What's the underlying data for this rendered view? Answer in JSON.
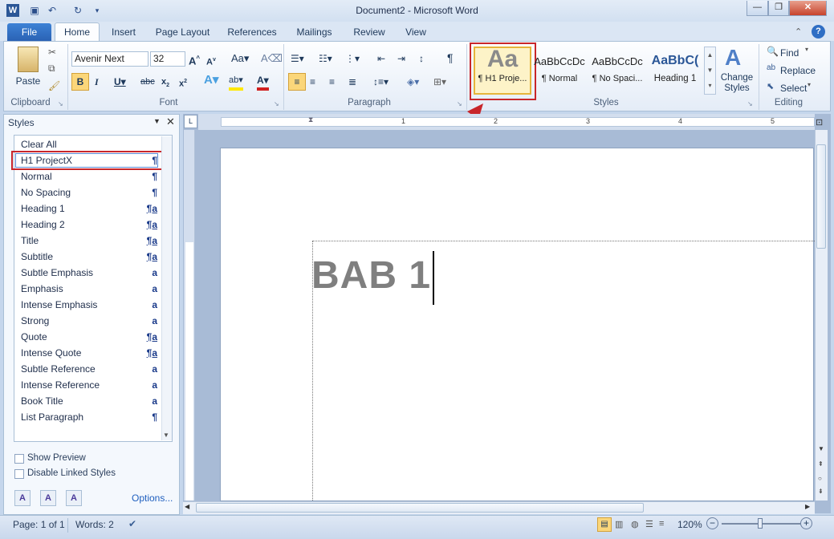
{
  "window": {
    "title": "Document2 - Microsoft Word"
  },
  "tabs": {
    "file": "File",
    "home": "Home",
    "insert": "Insert",
    "page_layout": "Page Layout",
    "references": "References",
    "mailings": "Mailings",
    "review": "Review",
    "view": "View"
  },
  "ribbon": {
    "clipboard": {
      "label": "Clipboard",
      "paste": "Paste"
    },
    "font": {
      "label": "Font",
      "name": "Avenir Next",
      "size": "32"
    },
    "paragraph": {
      "label": "Paragraph"
    },
    "styles": {
      "label": "Styles",
      "items": [
        {
          "sample": "Aa",
          "name": "¶ H1 Proje..."
        },
        {
          "sample": "AaBbCcDc",
          "name": "¶ Normal"
        },
        {
          "sample": "AaBbCcDc",
          "name": "¶ No Spaci..."
        },
        {
          "sample": "AaBbC(",
          "name": "Heading 1"
        }
      ],
      "change_styles": "Change Styles"
    },
    "editing": {
      "label": "Editing",
      "find": "Find",
      "replace": "Replace",
      "select": "Select"
    }
  },
  "styles_pane": {
    "title": "Styles",
    "items": [
      {
        "label": "Clear All",
        "mark": ""
      },
      {
        "label": "H1 ProjectX",
        "mark": "¶"
      },
      {
        "label": "Normal",
        "mark": "¶"
      },
      {
        "label": "No Spacing",
        "mark": "¶"
      },
      {
        "label": "Heading 1",
        "mark": "¶a"
      },
      {
        "label": "Heading 2",
        "mark": "¶a"
      },
      {
        "label": "Title",
        "mark": "¶a"
      },
      {
        "label": "Subtitle",
        "mark": "¶a"
      },
      {
        "label": "Subtle Emphasis",
        "mark": "a"
      },
      {
        "label": "Emphasis",
        "mark": "a"
      },
      {
        "label": "Intense Emphasis",
        "mark": "a"
      },
      {
        "label": "Strong",
        "mark": "a"
      },
      {
        "label": "Quote",
        "mark": "¶a"
      },
      {
        "label": "Intense Quote",
        "mark": "¶a"
      },
      {
        "label": "Subtle Reference",
        "mark": "a"
      },
      {
        "label": "Intense Reference",
        "mark": "a"
      },
      {
        "label": "Book Title",
        "mark": "a"
      },
      {
        "label": "List Paragraph",
        "mark": "¶"
      }
    ],
    "show_preview": "Show Preview",
    "disable_linked": "Disable Linked Styles",
    "options": "Options..."
  },
  "document": {
    "heading": "BAB 1"
  },
  "ruler": {
    "marks": [
      "1",
      "1",
      "2",
      "3",
      "4",
      "5"
    ]
  },
  "status": {
    "page": "Page: 1 of 1",
    "words": "Words: 2",
    "zoom": "120%"
  },
  "colors": {
    "accent_red": "#c8262b",
    "file_tab": "#2a62b4"
  }
}
